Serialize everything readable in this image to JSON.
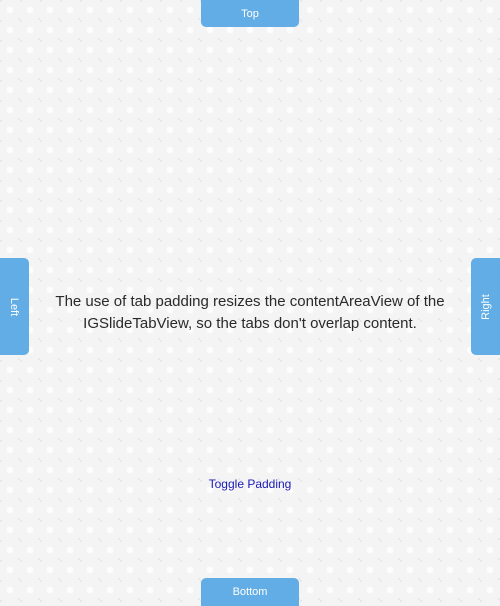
{
  "tabs": {
    "top": "Top",
    "bottom": "Bottom",
    "left": "Left",
    "right": "Right"
  },
  "content": {
    "description": "The use of tab padding resizes the contentAreaView of the IGSlideTabView, so the tabs don't overlap content.",
    "toggle_label": "Toggle Padding"
  },
  "colors": {
    "tab_background": "#62ade5",
    "tab_text": "#ffffff",
    "link": "#1a1ab8",
    "body_text": "#2a2a2a",
    "background": "#f4f4f4"
  }
}
